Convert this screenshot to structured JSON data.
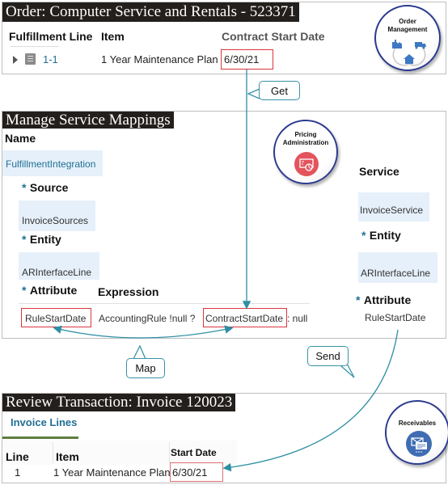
{
  "order_panel": {
    "title": "Order: Computer Service and Rentals - 523371",
    "columns": [
      "Fulfillment Line",
      "Item",
      "Contract Start Date"
    ],
    "row": {
      "line": "1-1",
      "item": "1 Year Maintenance Plan",
      "contract_start_date": "6/30/21"
    },
    "badge": {
      "line1": "Order",
      "line2": "Management",
      "icon": "factory-truck-home-icon"
    }
  },
  "callouts": {
    "get": "Get",
    "map": "Map",
    "send": "Send"
  },
  "mapping_panel": {
    "title": "Manage Service Mappings",
    "name_label": "Name",
    "name_value": "FulfillmentIntegration",
    "source_label": "Source",
    "source_value": "InvoiceSources",
    "entity_label": "Entity",
    "entity_value": "ARInterfaceLine",
    "attribute_label": "Attribute",
    "expression_label": "Expression",
    "attribute_value": "RuleStartDate",
    "expression_prefix": "AccountingRule !null ?",
    "expression_highlight": "ContractStartDate",
    "expression_suffix": ": null",
    "badge": {
      "line1": "Pricing",
      "line2": "Administration",
      "icon": "pricing-icon"
    },
    "service_label": "Service",
    "service_value": "InvoiceService",
    "target_entity_label": "Entity",
    "target_entity_value": "ARInterfaceLine",
    "target_attribute_label": "Attribute",
    "target_attribute_value": "RuleStartDate",
    "required_mark": "*"
  },
  "invoice_panel": {
    "title": "Review Transaction: Invoice 120023",
    "tab": "Invoice Lines",
    "columns": [
      "Line",
      "Item",
      "Start Date"
    ],
    "row": {
      "line": "1",
      "item": "1 Year Maintenance Plan",
      "start_date": "6/30/21"
    },
    "badge": {
      "line1": "Receivables",
      "icon": "invoice-envelope-icon"
    }
  },
  "colors": {
    "arrow": "#2e8fa3",
    "highlight_box": "#d9363e",
    "title_bar": "#231f1c",
    "link": "#1f6f94"
  }
}
